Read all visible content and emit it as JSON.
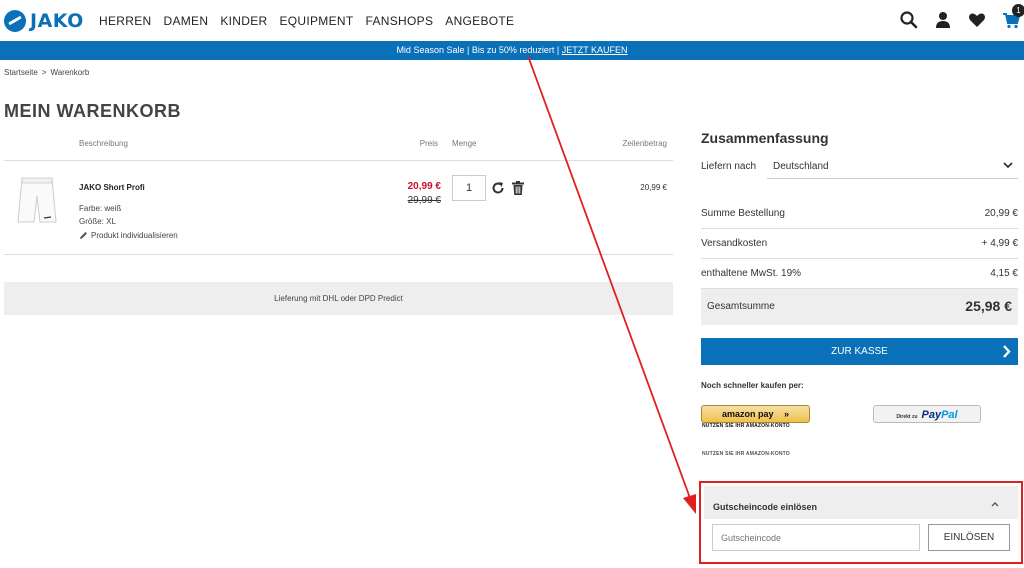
{
  "header": {
    "logo_text": "JAKO",
    "nav": [
      "HERREN",
      "DAMEN",
      "KINDER",
      "EQUIPMENT",
      "FANSHOPS",
      "ANGEBOTE"
    ],
    "cart_count": "1"
  },
  "promo": {
    "text": "Mid Season Sale | Bis zu 50% reduziert | ",
    "link": "JETZT KAUFEN"
  },
  "breadcrumb": {
    "home": "Startseite",
    "separator": ">",
    "current": "Warenkorb"
  },
  "page_title": "MEIN WARENKORB",
  "cart": {
    "headers": {
      "description": "Beschreibung",
      "price": "Preis",
      "quantity": "Menge",
      "line_total": "Zeilenbetrag"
    },
    "item": {
      "name": "JAKO Short Profi",
      "color": "Farbe: weiß",
      "size": "Größe: XL",
      "customize": "Produkt individualisieren",
      "price_now": "20,99 €",
      "price_old": "29,99 €",
      "quantity": "1",
      "line_total": "20,99 €"
    },
    "delivery_note": "Lieferung mit DHL oder DPD Predict"
  },
  "summary": {
    "title": "Zusammenfassung",
    "ship_label": "Liefern nach",
    "ship_country": "Deutschland",
    "rows": [
      {
        "label": "Summe Bestellung",
        "value": "20,99 €"
      },
      {
        "label": "Versandkosten",
        "value": "+ 4,99 €"
      },
      {
        "label": "enthaltene MwSt. 19%",
        "value": "4,15 €"
      }
    ],
    "total_label": "Gesamtsumme",
    "total_value": "25,98 €",
    "checkout_label": "ZUR KASSE",
    "faster_label": "Noch schneller kaufen per:",
    "amazon_label": "amazon pay",
    "amazon_sub": "NUTZEN SIE IHR AMAZON-KONTO",
    "paypal_pre": "Direkt zu",
    "paypal_pay": "Pay",
    "paypal_pal": "Pal"
  },
  "voucher": {
    "title": "Gutscheincode einlösen",
    "placeholder": "Gutscheincode",
    "button": "EINLÖSEN"
  },
  "colors": {
    "brand": "#0a71b8",
    "sale": "#c8102e",
    "annotation": "#e02020"
  }
}
